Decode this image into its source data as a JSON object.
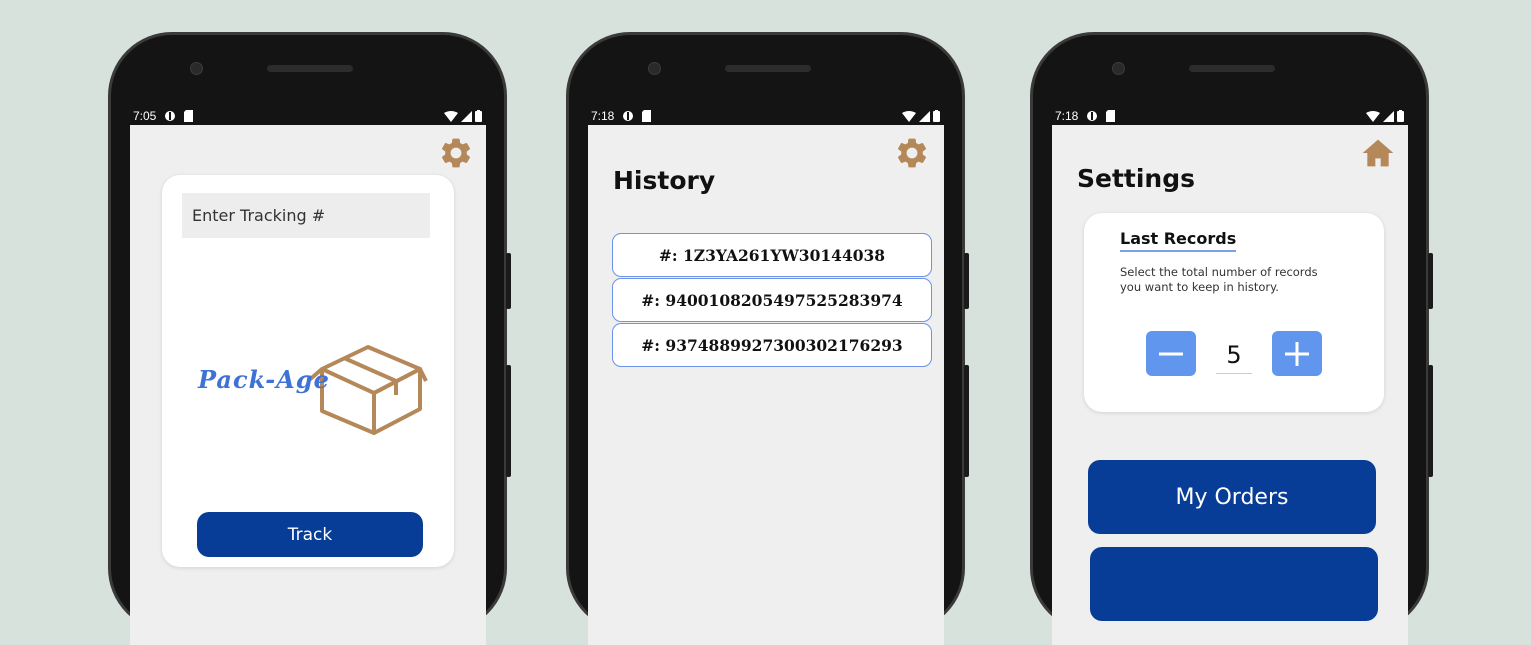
{
  "phone1": {
    "status": {
      "time": "7:05"
    },
    "tracking_input": {
      "placeholder": "Enter Tracking #"
    },
    "logo": {
      "text": "Pack-Age"
    },
    "track_button": {
      "label": "Track"
    }
  },
  "phone2": {
    "status": {
      "time": "7:18"
    },
    "title": "History",
    "history": [
      {
        "prefix": "#: ",
        "number": "1Z3YA261YW30144038"
      },
      {
        "prefix": "#: ",
        "number": "9400108205497525283974"
      },
      {
        "prefix": "#: ",
        "number": "9374889927300302176293"
      }
    ]
  },
  "phone3": {
    "status": {
      "time": "7:18"
    },
    "title": "Settings",
    "last_records": {
      "heading": "Last Records",
      "description": "Select the total number of records you want to keep in history.",
      "value": "5"
    },
    "my_orders_button": {
      "label": "My Orders"
    }
  },
  "colors": {
    "background": "#d7e2dd",
    "accent_brown": "#b5885a",
    "primary_blue": "#073d96",
    "stepper_blue": "#6196ee",
    "history_border": "#6c93e8"
  },
  "icons": {
    "settings": "gear-icon",
    "home": "home-icon",
    "status": [
      "wifi-icon",
      "signal-icon",
      "battery-icon"
    ]
  }
}
